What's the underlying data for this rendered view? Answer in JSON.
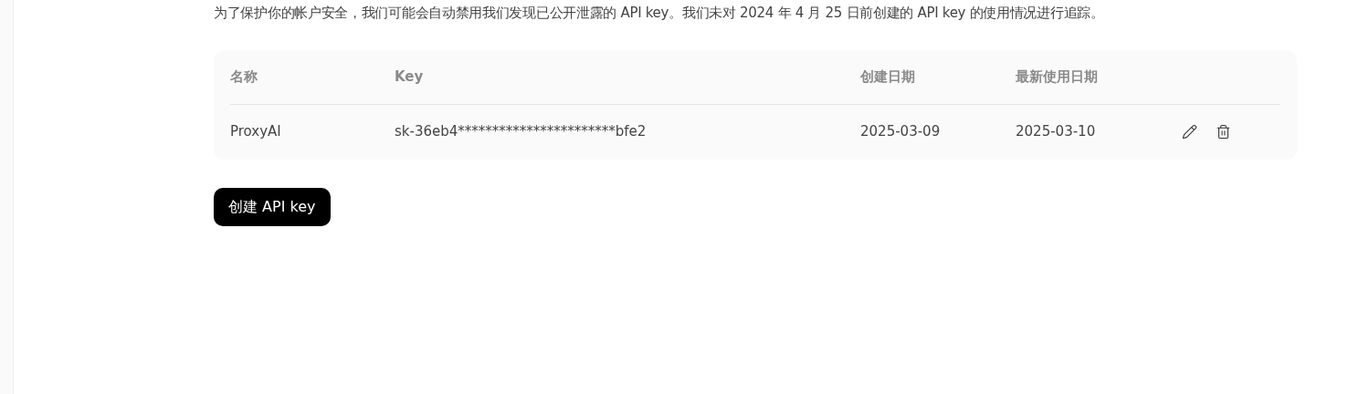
{
  "notice": "为了保护你的帐户安全，我们可能会自动禁用我们发现已公开泄露的 API key。我们未对 2024 年 4 月 25 日前创建的 API key 的使用情况进行追踪。",
  "table": {
    "columns": [
      "名称",
      "Key",
      "创建日期",
      "最新使用日期"
    ],
    "rows": [
      {
        "cells": [
          "ProxyAI",
          "sk-36eb4***********************bfe2",
          "2025-03-09",
          "2025-03-10"
        ]
      }
    ]
  },
  "create_button": "创建 API key"
}
